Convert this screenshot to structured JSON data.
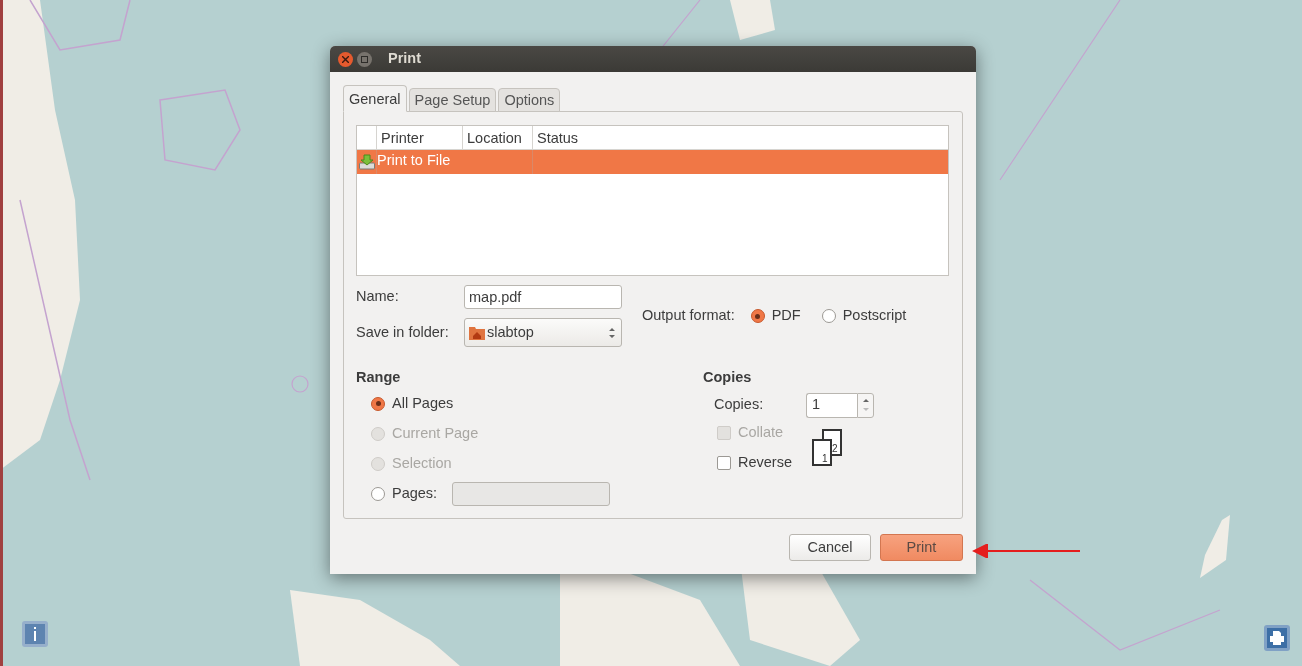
{
  "window": {
    "title": "Print"
  },
  "tabs": [
    {
      "label": "General",
      "selected": true
    },
    {
      "label": "Page Setup",
      "selected": false
    },
    {
      "label": "Options",
      "selected": false
    }
  ],
  "printers": {
    "columns": [
      "Printer",
      "Location",
      "Status"
    ],
    "rows": [
      {
        "printer": "Print to File",
        "selected": true
      }
    ]
  },
  "name_field": {
    "label": "Name:",
    "value": "map.pdf"
  },
  "folder_field": {
    "label": "Save in folder:",
    "value": "slabtop"
  },
  "output_format": {
    "label": "Output format:",
    "options": [
      {
        "label": "PDF",
        "selected": true
      },
      {
        "label": "Postscript",
        "selected": false
      }
    ]
  },
  "range": {
    "heading": "Range",
    "options": [
      {
        "label": "All Pages",
        "selected": true,
        "disabled": false
      },
      {
        "label": "Current Page",
        "selected": false,
        "disabled": true
      },
      {
        "label": "Selection",
        "selected": false,
        "disabled": true
      },
      {
        "label": "Pages:",
        "selected": false,
        "disabled": false,
        "kind": "entry"
      }
    ]
  },
  "copies": {
    "heading": "Copies",
    "label": "Copies:",
    "value": "1",
    "options": [
      {
        "label": "Collate",
        "checked": false,
        "disabled": true
      },
      {
        "label": "Reverse",
        "checked": false,
        "disabled": false
      }
    ],
    "pages": [
      "1",
      "2"
    ]
  },
  "buttons": [
    {
      "label": "Cancel",
      "kind": "secondary"
    },
    {
      "label": "Print",
      "kind": "primary"
    }
  ]
}
